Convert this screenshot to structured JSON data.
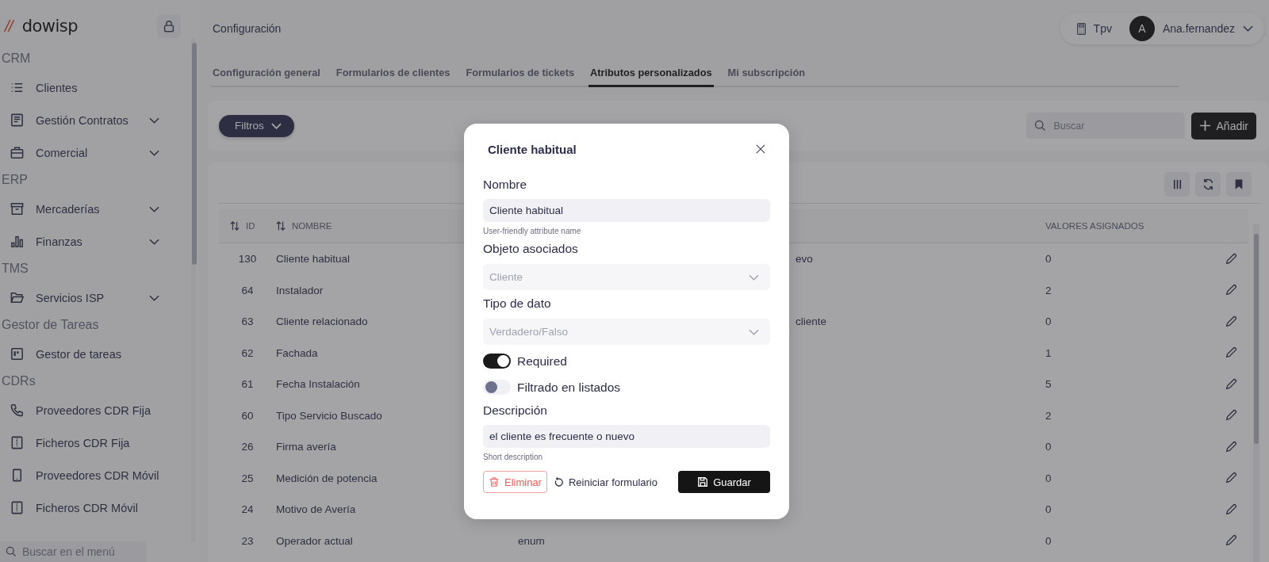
{
  "sidebar": {
    "logo": {
      "mark": "//",
      "name": "dowisp"
    },
    "sections": [
      {
        "title": "CRM",
        "items": [
          {
            "label": "Clientes",
            "expandable": false
          },
          {
            "label": "Gestión Contratos",
            "expandable": true
          },
          {
            "label": "Comercial",
            "expandable": true
          }
        ]
      },
      {
        "title": "ERP",
        "items": [
          {
            "label": "Mercaderías",
            "expandable": true
          },
          {
            "label": "Finanzas",
            "expandable": true
          }
        ]
      },
      {
        "title": "TMS",
        "items": [
          {
            "label": "Servicios ISP",
            "expandable": true
          }
        ]
      },
      {
        "title": "Gestor de Tareas",
        "items": [
          {
            "label": "Gestor de tareas",
            "expandable": false
          }
        ]
      },
      {
        "title": "CDRs",
        "items": [
          {
            "label": "Proveedores CDR Fija",
            "expandable": false
          },
          {
            "label": "Ficheros CDR Fija",
            "expandable": false
          },
          {
            "label": "Proveedores CDR Móvil",
            "expandable": false
          },
          {
            "label": "Ficheros CDR Móvil",
            "expandable": false
          }
        ]
      }
    ],
    "search": {
      "placeholder": "Buscar en el menú"
    }
  },
  "header": {
    "title": "Configuración",
    "tpv": "Tpv",
    "user": {
      "initial": "A",
      "name": "Ana.fernandez"
    }
  },
  "tabs": [
    {
      "label": "Configuración general",
      "selected": false
    },
    {
      "label": "Formularios de clientes",
      "selected": false
    },
    {
      "label": "Formularios de tickets",
      "selected": false
    },
    {
      "label": "Atributos personalizados",
      "selected": true
    },
    {
      "label": "Mi subscripción",
      "selected": false
    }
  ],
  "toolbar": {
    "filter_button": "Filtros",
    "search": {
      "placeholder": "Buscar"
    },
    "add_button": "Añadir"
  },
  "table": {
    "columns": [
      {
        "label": "ID",
        "sortable": true
      },
      {
        "label": "NOMBRE",
        "sortable": true
      },
      {
        "label": "VALORES ASIGNADOS",
        "sortable": false
      }
    ],
    "rows": [
      {
        "id": "130",
        "name": "Cliente habitual",
        "column_4": "evo",
        "values": "0"
      },
      {
        "id": "64",
        "name": "Instalador",
        "values": "2"
      },
      {
        "id": "63",
        "name": "Cliente relacionado",
        "column_4": "cliente",
        "values": "0"
      },
      {
        "id": "62",
        "name": "Fachada",
        "values": "1"
      },
      {
        "id": "61",
        "name": "Fecha Instalación",
        "values": "5"
      },
      {
        "id": "60",
        "name": "Tipo Servicio Buscado",
        "values": "2"
      },
      {
        "id": "26",
        "name": "Firma avería",
        "values": "0"
      },
      {
        "id": "25",
        "name": "Medición de potencia",
        "values": "0"
      },
      {
        "id": "24",
        "name": "Motivo de Avería",
        "values": "0"
      },
      {
        "id": "23",
        "name": "Operador actual",
        "column_3": "enum",
        "values": "0"
      }
    ]
  },
  "modal": {
    "title": "Cliente habitual",
    "fields": [
      {
        "kind": "text",
        "label": "Nombre",
        "value": "Cliente habitual",
        "help": "User-friendly attribute name"
      },
      {
        "kind": "select",
        "label": "Objeto asociados",
        "value": "Cliente",
        "disabled": true
      },
      {
        "kind": "select",
        "label": "Tipo de dato",
        "value": "Verdadero/Falso",
        "disabled": true
      },
      {
        "kind": "toggle",
        "label": "Required",
        "on": true
      },
      {
        "kind": "toggle",
        "label": "Filtrado en listados",
        "on": false
      },
      {
        "kind": "text",
        "label": "Descripción",
        "value": "el cliente es frecuente o nuevo",
        "help": "Short description"
      }
    ],
    "buttons": [
      {
        "kind": "danger",
        "label": "Eliminar"
      },
      {
        "kind": "link",
        "label": "Reiniciar formulario"
      },
      {
        "kind": "primary",
        "label": "Guardar"
      }
    ]
  }
}
